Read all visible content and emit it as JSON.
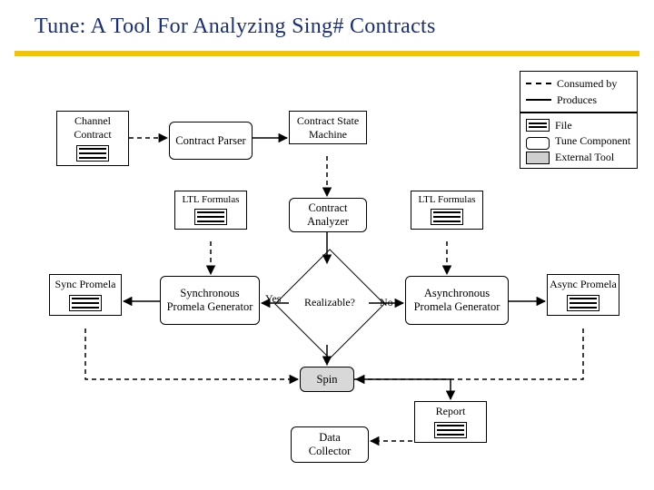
{
  "title": "Tune: A Tool For Analyzing Sing# Contracts",
  "legendArrows": {
    "consumed": "Consumed by",
    "produces": "Produces"
  },
  "legendTypes": {
    "file": "File",
    "component": "Tune Component",
    "external": "External Tool"
  },
  "nodes": {
    "channelContract": "Channel Contract",
    "contractParser": "Contract Parser",
    "contractStateMachine": "Contract State Machine",
    "ltlLeft": "LTL Formulas",
    "ltlRight": "LTL Formulas",
    "contractAnalyzer": "Contract Analyzer",
    "syncPromela": "Sync Promela",
    "asyncPromela": "Async Promela",
    "syncGen": "Synchronous Promela Generator",
    "asyncGen": "Asynchronous Promela Generator",
    "realizable": "Realizable?",
    "spin": "Spin",
    "dataCollector": "Data Collector",
    "report": "Report"
  },
  "edgeLabels": {
    "yes": "Yes",
    "no": "No"
  }
}
